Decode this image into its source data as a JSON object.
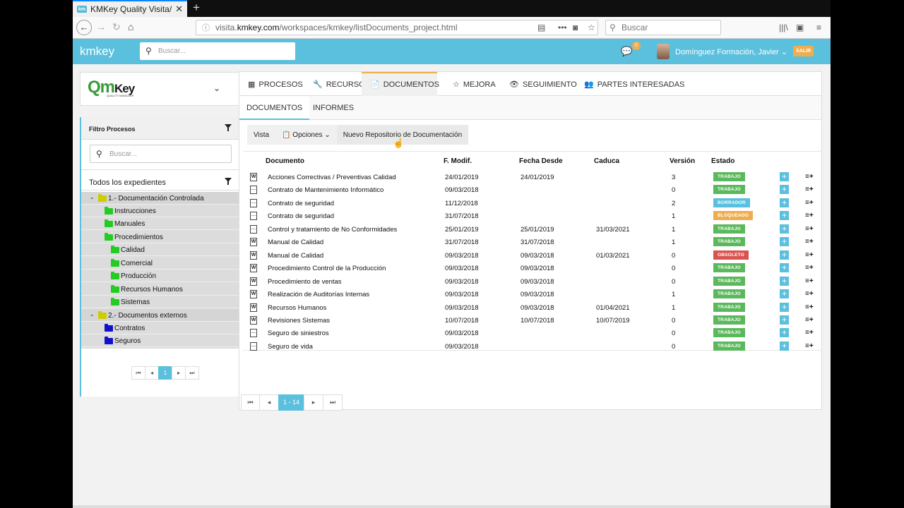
{
  "browser": {
    "tab_title": "KMKey Quality Visita/Do",
    "tab_favicon": "km",
    "url_prefix": "visita.",
    "url_domain": "kmkey.com",
    "url_path": "/workspaces/kmkey/listDocuments_project.html",
    "search_placeholder": "Buscar"
  },
  "header": {
    "logo_km": "km",
    "logo_key": "key",
    "search_placeholder": "Buscar...",
    "chat_count": "0",
    "user_name": "Domínguez Formación, Javier",
    "logout": "SALIR",
    "accent": "#5bc0de"
  },
  "org": {
    "logo_q": "Qm",
    "logo_key": "Key",
    "logo_sub": "QUALITY MANAGER"
  },
  "left": {
    "filter_title": "Filtro Procesos",
    "search_placeholder": "Buscar...",
    "all_title": "Todos los expedientes",
    "tree": [
      {
        "label": "1.- Documentación Controlada",
        "indent": 0,
        "expand": true,
        "color": "#cccc00"
      },
      {
        "label": "Instrucciones",
        "indent": 1,
        "color": "#22cc22"
      },
      {
        "label": "Manuales",
        "indent": 1,
        "color": "#22cc22"
      },
      {
        "label": "Procedimientos",
        "indent": 1,
        "color": "#22cc22"
      },
      {
        "label": "Calidad",
        "indent": 2,
        "color": "#22cc22"
      },
      {
        "label": "Comercial",
        "indent": 2,
        "color": "#22cc22"
      },
      {
        "label": "Producción",
        "indent": 2,
        "color": "#22cc22"
      },
      {
        "label": "Recursos Humanos",
        "indent": 2,
        "color": "#22cc22"
      },
      {
        "label": "Sistemas",
        "indent": 2,
        "color": "#22cc22"
      },
      {
        "label": "2.- Documentos externos",
        "indent": 0,
        "expand": true,
        "color": "#cccc00"
      },
      {
        "label": "Contratos",
        "indent": 1,
        "color": "#1111cc"
      },
      {
        "label": "Seguros",
        "indent": 1,
        "color": "#1111cc"
      }
    ],
    "pager": {
      "first": "⏮",
      "prev": "◂",
      "page": "1",
      "next": "▸",
      "last": "⏭"
    }
  },
  "tabs": [
    {
      "label": "PROCESOS",
      "icon": "grid-icon"
    },
    {
      "label": "RECURSOS",
      "icon": "wrench-icon"
    },
    {
      "label": "DOCUMENTOS",
      "icon": "documents-icon",
      "active": true
    },
    {
      "label": "MEJORA",
      "icon": "star-icon"
    },
    {
      "label": "SEGUIMIENTO",
      "icon": "eye-icon"
    },
    {
      "label": "PARTES INTERESADAS",
      "icon": "users-icon"
    }
  ],
  "subtabs": [
    {
      "label": "DOCUMENTOS",
      "active": true
    },
    {
      "label": "INFORMES"
    }
  ],
  "toolbar": {
    "view": "Vista",
    "options": "Opciones",
    "new_repo": "Nuevo Repositorio de Documentación"
  },
  "table": {
    "headers": [
      "Documento",
      "F. Modif.",
      "Fecha Desde",
      "Caduca",
      "Versión",
      "Estado"
    ],
    "rows": [
      {
        "icon": "W",
        "doc": "Acciones Correctivas / Preventivas Calidad",
        "mod": "24/01/2019",
        "desde": "24/01/2019",
        "caduca": "",
        "ver": "3",
        "estado": "TRABAJO"
      },
      {
        "icon": "",
        "doc": "Contrato de Mantenimiento Informático",
        "mod": "09/03/2018",
        "desde": "",
        "caduca": "",
        "ver": "0",
        "estado": "TRABAJO"
      },
      {
        "icon": "",
        "doc": "Contrato de seguridad",
        "mod": "11/12/2018",
        "desde": "",
        "caduca": "",
        "ver": "2",
        "estado": "BORRADOR"
      },
      {
        "icon": "",
        "doc": "Contrato de seguridad",
        "mod": "31/07/2018",
        "desde": "",
        "caduca": "",
        "ver": "1",
        "estado": "BLOQUEADO"
      },
      {
        "icon": "",
        "doc": "Control y tratamiento de No Conformidades",
        "mod": "25/01/2019",
        "desde": "25/01/2019",
        "caduca": "31/03/2021",
        "ver": "1",
        "estado": "TRABAJO"
      },
      {
        "icon": "W",
        "doc": "Manual de Calidad",
        "mod": "31/07/2018",
        "desde": "31/07/2018",
        "caduca": "",
        "ver": "1",
        "estado": "TRABAJO"
      },
      {
        "icon": "W",
        "doc": "Manual de Calidad",
        "mod": "09/03/2018",
        "desde": "09/03/2018",
        "caduca": "01/03/2021",
        "ver": "0",
        "estado": "OBSOLETO"
      },
      {
        "icon": "W",
        "doc": "Procedimiento Control de la Producción",
        "mod": "09/03/2018",
        "desde": "09/03/2018",
        "caduca": "",
        "ver": "0",
        "estado": "TRABAJO"
      },
      {
        "icon": "W",
        "doc": "Procedimiento de ventas",
        "mod": "09/03/2018",
        "desde": "09/03/2018",
        "caduca": "",
        "ver": "0",
        "estado": "TRABAJO"
      },
      {
        "icon": "W",
        "doc": "Realización de Auditorías Internas",
        "mod": "09/03/2018",
        "desde": "09/03/2018",
        "caduca": "",
        "ver": "1",
        "estado": "TRABAJO"
      },
      {
        "icon": "W",
        "doc": "Recursos Humanos",
        "mod": "09/03/2018",
        "desde": "09/03/2018",
        "caduca": "01/04/2021",
        "ver": "1",
        "estado": "TRABAJO"
      },
      {
        "icon": "W",
        "doc": "Revisiones Sistemas",
        "mod": "10/07/2018",
        "desde": "10/07/2018",
        "caduca": "10/07/2019",
        "ver": "0",
        "estado": "TRABAJO"
      },
      {
        "icon": "",
        "doc": "Seguro de siniestros",
        "mod": "09/03/2018",
        "desde": "",
        "caduca": "",
        "ver": "0",
        "estado": "TRABAJO"
      },
      {
        "icon": "",
        "doc": "Seguro de vida",
        "mod": "09/03/2018",
        "desde": "",
        "caduca": "",
        "ver": "0",
        "estado": "TRABAJO"
      }
    ],
    "status_colors": {
      "TRABAJO": "#5cb85c",
      "BORRADOR": "#5bc0de",
      "BLOQUEADO": "#f0ad4e",
      "OBSOLETO": "#d9534f"
    }
  },
  "pager": {
    "first": "⏮",
    "prev": "◂",
    "range": "1 - 14",
    "next": "▸",
    "last": "⏭"
  }
}
